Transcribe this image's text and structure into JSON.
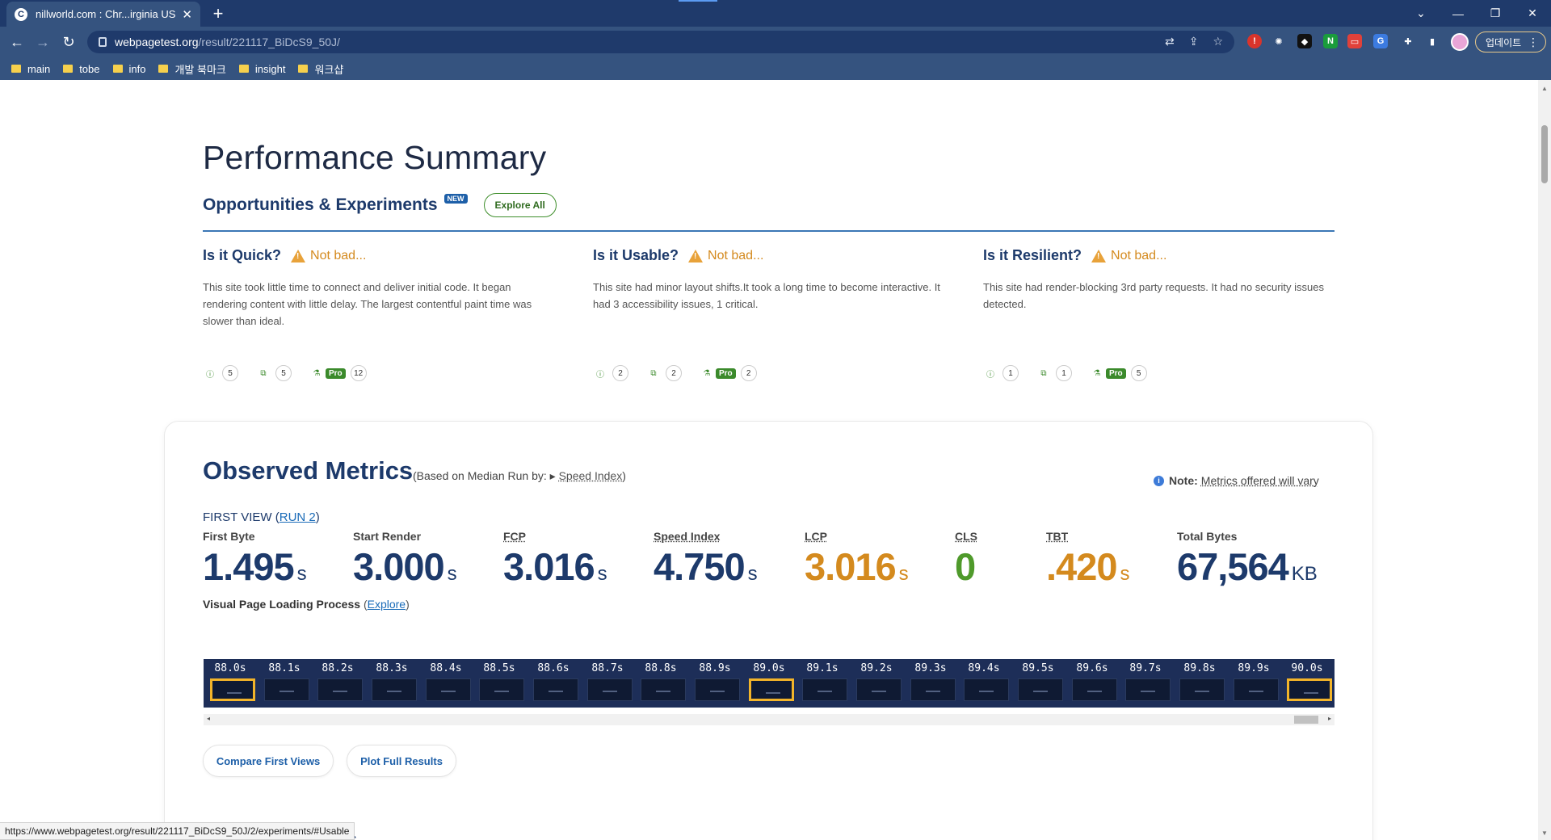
{
  "browser": {
    "tab_title": "nillworld.com : Chr...irginia USA",
    "url_host": "webpagetest.org",
    "url_path": "/result/221117_BiDcS9_50J/",
    "update_label": "업데이트",
    "bookmarks": [
      "main",
      "tobe",
      "info",
      "개발 북마크",
      "insight",
      "워크샵"
    ]
  },
  "performance": {
    "title": "Performance Summary",
    "opp_title": "Opportunities & Experiments",
    "new_badge": "NEW",
    "explore_all": "Explore All",
    "columns": [
      {
        "question": "Is it Quick?",
        "verdict": "Not bad...",
        "desc": "This site took little time to connect and deliver initial code. It began rendering content with little delay. The largest contentful paint time was slower than ideal.",
        "counts": [
          "5",
          "5",
          "12"
        ]
      },
      {
        "question": "Is it Usable?",
        "verdict": "Not bad...",
        "desc": "This site had minor layout shifts.It took a long time to become interactive. It had 3 accessibility issues, 1 critical.",
        "counts": [
          "2",
          "2",
          "2"
        ]
      },
      {
        "question": "Is it Resilient?",
        "verdict": "Not bad...",
        "desc": "This site had render-blocking 3rd party requests. It had no security issues detected.",
        "counts": [
          "1",
          "1",
          "5"
        ]
      }
    ],
    "pro_label": "Pro"
  },
  "observed": {
    "title": "Observed Metrics",
    "sub_prefix": "(Based on Median Run by:",
    "sub_link": "Speed Index",
    "sub_suffix": ")",
    "note_label": "Note:",
    "note_text": "Metrics offered will vary",
    "firstview_prefix": "FIRST VIEW (",
    "run_link": "RUN 2",
    "firstview_suffix": ")",
    "metrics": [
      {
        "label": "First Byte",
        "value": "1.495",
        "unit": "s"
      },
      {
        "label": "Start Render",
        "value": "3.000",
        "unit": "s"
      },
      {
        "label": "FCP",
        "value": "3.016",
        "unit": "s"
      },
      {
        "label": "Speed Index",
        "value": "4.750",
        "unit": "s"
      },
      {
        "label": "LCP",
        "value": "3.016",
        "unit": "s"
      },
      {
        "label": "CLS",
        "value": "0",
        "unit": ""
      },
      {
        "label": "TBT",
        "value": ".420",
        "unit": "s"
      },
      {
        "label": "Total Bytes",
        "value": "67,564",
        "unit": "KB"
      }
    ],
    "vpl_label": "Visual Page Loading Process",
    "vpl_explore": "Explore",
    "frames": [
      "88.0s",
      "88.1s",
      "88.2s",
      "88.3s",
      "88.4s",
      "88.5s",
      "88.6s",
      "88.7s",
      "88.8s",
      "88.9s",
      "89.0s",
      "89.1s",
      "89.2s",
      "89.3s",
      "89.4s",
      "89.5s",
      "89.6s",
      "89.7s",
      "89.8s",
      "89.9s",
      "90.0s"
    ],
    "selected_frames": [
      "88.0s",
      "89.0s",
      "90.0s"
    ],
    "compare_btn": "Compare First Views",
    "plot_btn": "Plot Full Results"
  },
  "status_url": "https://www.webpagetest.org/result/221117_BiDcS9_50J/2/experiments/#Usable",
  "peek_text": "ns",
  "colors": {
    "chrome_dark": "#1f3a6b",
    "chrome_light": "#35537f",
    "navy": "#1d3a6b",
    "orange": "#d48a1e",
    "green": "#4f9a2b",
    "highlight": "#f2b42a"
  }
}
